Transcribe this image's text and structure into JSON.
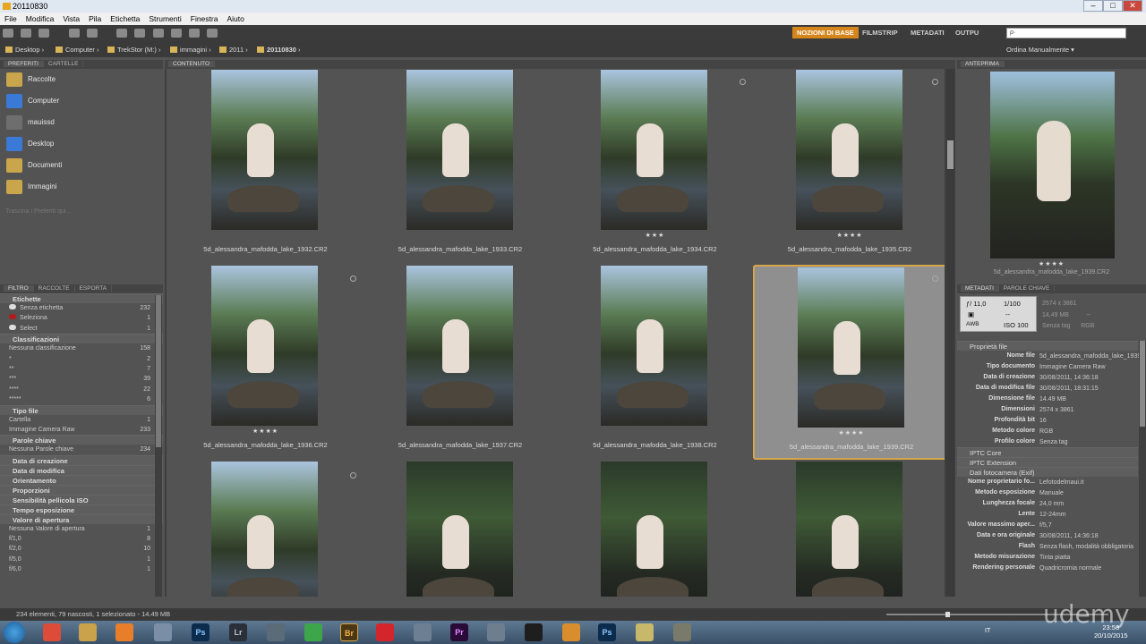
{
  "window": {
    "title": "20110830"
  },
  "menu": [
    "File",
    "Modifica",
    "Vista",
    "Pila",
    "Etichetta",
    "Strumenti",
    "Finestra",
    "Aiuto"
  ],
  "workspaces": [
    {
      "label": "NOZIONI DI BASE",
      "active": true
    },
    {
      "label": "FILMSTRIP",
      "active": false
    },
    {
      "label": "METADATI",
      "active": false
    },
    {
      "label": "OUTPU",
      "active": false
    }
  ],
  "search": {
    "placeholder": "ρ·"
  },
  "path": [
    "Desktop",
    "Computer",
    "TrekStor (M:)",
    "immagini",
    "2011",
    "20110830"
  ],
  "sort": {
    "label": "Ordina Manualmente"
  },
  "left": {
    "tabs": [
      "PREFERITI",
      "CARTELLE"
    ],
    "favorites": [
      "Raccolte",
      "Computer",
      "mauissd",
      "Desktop",
      "Documenti",
      "Immagini"
    ],
    "fav_hint": "Trascina i Preferiti qui...",
    "filter_tabs": [
      "FILTRO",
      "RACCOLTE",
      "ESPORTA"
    ],
    "sections": [
      {
        "title": "Etichette",
        "items": [
          {
            "label": "Senza etichetta",
            "count": "232"
          },
          {
            "label": "Seleziona",
            "count": "1"
          },
          {
            "label": "Select",
            "count": "1"
          }
        ]
      },
      {
        "title": "Classificazioni",
        "items": [
          {
            "label": "Nessuna classificazione",
            "count": "158"
          },
          {
            "label": "*",
            "count": "2"
          },
          {
            "label": "**",
            "count": "7"
          },
          {
            "label": "***",
            "count": "39"
          },
          {
            "label": "****",
            "count": "22"
          },
          {
            "label": "*****",
            "count": "6"
          }
        ]
      },
      {
        "title": "Tipo file",
        "items": [
          {
            "label": "Cartella",
            "count": "1"
          },
          {
            "label": "Immagine Camera Raw",
            "count": "233"
          }
        ]
      },
      {
        "title": "Parole chiave",
        "items": [
          {
            "label": "Nessuna Parole chiave",
            "count": "234"
          }
        ]
      },
      {
        "title": "Data di creazione",
        "items": []
      },
      {
        "title": "Data di modifica",
        "items": []
      },
      {
        "title": "Orientamento",
        "items": []
      },
      {
        "title": "Proporzioni",
        "items": []
      },
      {
        "title": "Sensibilità pellicola ISO",
        "items": []
      },
      {
        "title": "Tempo esposizione",
        "items": []
      },
      {
        "title": "Valore di apertura",
        "items": [
          {
            "label": "Nessuna Valore di apertura",
            "count": "1"
          },
          {
            "label": "f/1,0",
            "count": "8"
          },
          {
            "label": "f/2,0",
            "count": "10"
          },
          {
            "label": "f/5,0",
            "count": "1"
          },
          {
            "label": "f/6,0",
            "count": "1"
          }
        ]
      }
    ]
  },
  "content": {
    "tab": "CONTENUTO",
    "thumbs": [
      {
        "name": "5d_alessandra_mafodda_lake_1932.CR2",
        "stars": "",
        "selected": false,
        "dark": false
      },
      {
        "name": "5d_alessandra_mafodda_lake_1933.CR2",
        "stars": "",
        "selected": false,
        "dark": false
      },
      {
        "name": "5d_alessandra_mafodda_lake_1934.CR2",
        "stars": "★★★",
        "selected": false,
        "dark": false
      },
      {
        "name": "5d_alessandra_mafodda_lake_1935.CR2",
        "stars": "★★★★",
        "selected": false,
        "dark": false
      },
      {
        "name": "5d_alessandra_mafodda_lake_1936.CR2",
        "stars": "★★★★",
        "selected": false,
        "dark": false
      },
      {
        "name": "5d_alessandra_mafodda_lake_1937.CR2",
        "stars": "",
        "selected": false,
        "dark": false
      },
      {
        "name": "5d_alessandra_mafodda_lake_1938.CR2",
        "stars": "",
        "selected": false,
        "dark": false
      },
      {
        "name": "5d_alessandra_mafodda_lake_1939.CR2",
        "stars": "★★★★",
        "selected": true,
        "dark": false
      },
      {
        "name": "",
        "stars": "",
        "selected": false,
        "dark": false
      },
      {
        "name": "",
        "stars": "",
        "selected": false,
        "dark": true
      },
      {
        "name": "",
        "stars": "",
        "selected": false,
        "dark": true
      },
      {
        "name": "",
        "stars": "",
        "selected": false,
        "dark": true
      }
    ]
  },
  "preview": {
    "tab": "ANTEPRIMA",
    "stars": "★★★★",
    "name": "5d_alessandra_mafodda_lake_1939.CR2"
  },
  "metadata": {
    "tabs": [
      "METADATI",
      "PAROLE CHIAVE"
    ],
    "placard": {
      "aperture": "ƒ/ 11,0",
      "shutter": "1/100",
      "dash1": "--",
      "dash2": "--",
      "awb": "AWB",
      "iso": "ISO 100"
    },
    "info": {
      "dims": "2574 x 3861",
      "size": "14,49 MB",
      "tag": "Senza tag",
      "dash": "--",
      "mode": "RGB"
    },
    "file_props_title": "Proprietà file",
    "file_props": [
      {
        "k": "Nome file",
        "v": "5d_alessandra_mafodda_lake_1939.CR2"
      },
      {
        "k": "Tipo documento",
        "v": "Immagine Camera Raw"
      },
      {
        "k": "Data di creazione",
        "v": "30/08/2011, 14:36:18"
      },
      {
        "k": "Data di modifica file",
        "v": "30/08/2011, 18:31:15"
      },
      {
        "k": "Dimensione file",
        "v": "14.49 MB"
      },
      {
        "k": "Dimensioni",
        "v": "2574 x 3861"
      },
      {
        "k": "Profondità bit",
        "v": "16"
      },
      {
        "k": "Metodo colore",
        "v": "RGB"
      },
      {
        "k": "Profilo colore",
        "v": "Senza tag"
      }
    ],
    "iptc_core": "IPTC Core",
    "iptc_ext": "IPTC Extension",
    "exif_title": "Dati fotocamera (Exif)",
    "exif": [
      {
        "k": "Nome proprietario fo...",
        "v": "Lefotodelmaui.it"
      },
      {
        "k": "Metodo esposizione",
        "v": "Manuale"
      },
      {
        "k": "Lunghezza focale",
        "v": "24,0 mm"
      },
      {
        "k": "Lente",
        "v": "12-24mm"
      },
      {
        "k": "Valore massimo aper...",
        "v": "f/5,7"
      },
      {
        "k": "Data e ora originale",
        "v": "30/08/2011, 14:36:18"
      },
      {
        "k": "Flash",
        "v": "Senza flash, modalità obbligatoria"
      },
      {
        "k": "Metodo misurazione",
        "v": "Tinta piatta"
      },
      {
        "k": "Rendering personale",
        "v": "Quadricromia normale"
      }
    ]
  },
  "status": {
    "text": "234 elementi, 79 nascosti, 1 selezionato - 14.49 MB"
  },
  "taskbar": {
    "time": "23:58",
    "date": "20/10/2015",
    "lang": "IT"
  },
  "watermark": "udemy"
}
